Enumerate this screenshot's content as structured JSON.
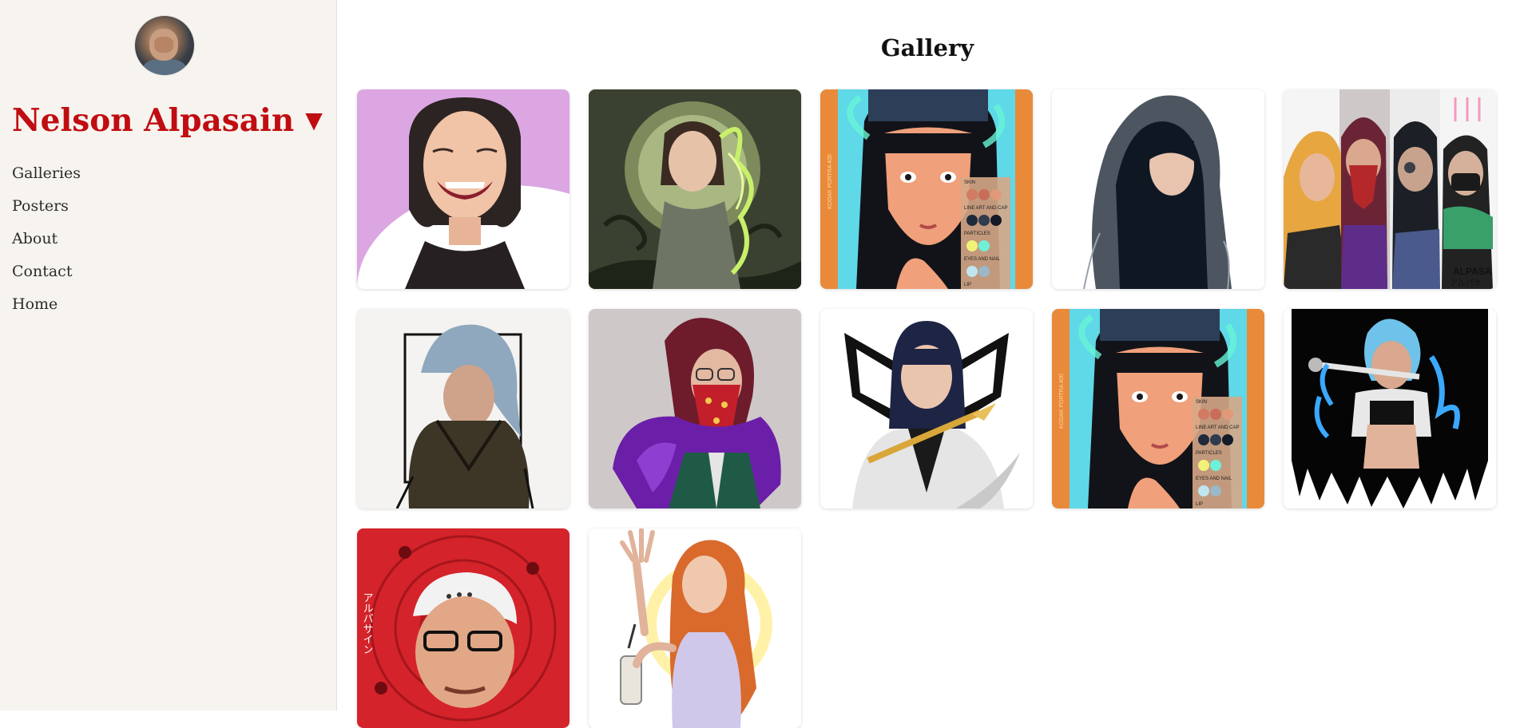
{
  "sidebar": {
    "title": "Nelson Alpasain",
    "caret": "▼",
    "nav": [
      "Galleries",
      "Posters",
      "About",
      "Contact",
      "Home"
    ]
  },
  "gallery": {
    "title": "Gallery",
    "items": [
      {
        "subject": "smiling woman portrait",
        "bg": "#d9a2e0"
      },
      {
        "subject": "woman with green flames",
        "bg": "#3c4230"
      },
      {
        "subject": "woman with color palette",
        "bg": "#5fd8e8"
      },
      {
        "subject": "woman in hoodie",
        "bg": "#ffffff"
      },
      {
        "subject": "group of four",
        "bg": "#f2f2f2"
      },
      {
        "subject": "blue-haired woman in jacket",
        "bg": "#f4f4f2"
      },
      {
        "subject": "masked man with purple fur",
        "bg": "#cfc8c9"
      },
      {
        "subject": "woman with dagger",
        "bg": "#ffffff"
      },
      {
        "subject": "woman with color palette",
        "bg": "#5fd8e8"
      },
      {
        "subject": "swordsman with blue flames",
        "bg": "#ffffff"
      },
      {
        "subject": "man with cap on red",
        "bg": "#d4232a"
      },
      {
        "subject": "waving woman with drink",
        "bg": "#ffffff"
      }
    ]
  },
  "tile_texts": {
    "palette_labels": [
      "SKIN",
      "LINE ART AND CAP",
      "PARTICLES",
      "EYES AND NAIL",
      "LIP"
    ],
    "film_text": "KODAK PORTRA 400",
    "kana_vertical": "アルパサイン",
    "kana_short": "アルパサ",
    "brand": "ALPASA"
  }
}
